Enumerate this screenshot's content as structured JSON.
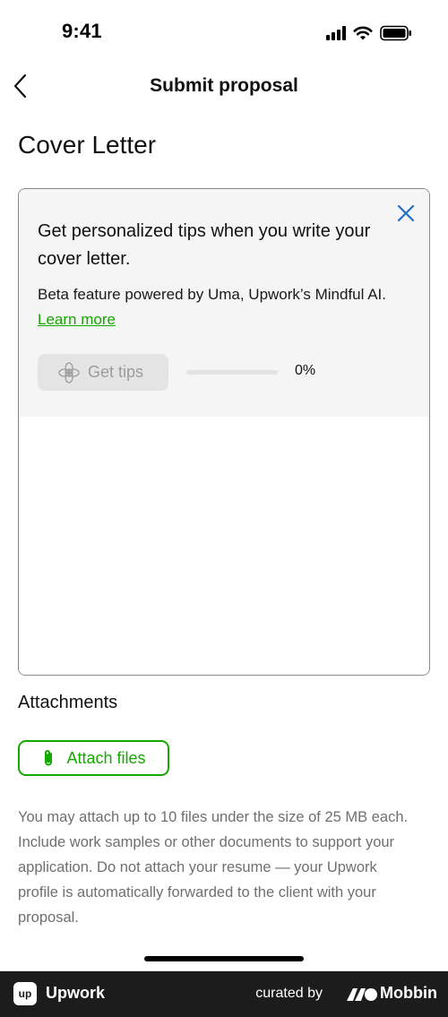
{
  "status_bar": {
    "time": "9:41",
    "icons": [
      "cellular-signal-icon",
      "wifi-icon",
      "battery-icon"
    ]
  },
  "nav": {
    "back_icon": "chevron-left-icon",
    "title": "Submit proposal"
  },
  "page": {
    "heading": "Cover Letter"
  },
  "tips": {
    "title": "Get personalized tips when you write your cover letter.",
    "description": "Beta feature powered by Uma, Upwork’s Mindful AI.",
    "learn_more": "Learn more",
    "button_label": "Get tips",
    "button_icon": "sparkle-flower-icon",
    "progress_percent": 0,
    "progress_label": "0%",
    "close_icon": "close-icon"
  },
  "cover_letter": {
    "value": "",
    "placeholder": ""
  },
  "attachments": {
    "heading": "Attachments",
    "button_label": "Attach files",
    "button_icon": "paperclip-icon",
    "note": "You may attach up to 10 files under the size of 25 MB each. Include work samples or other documents to support your application. Do not attach your resume — your Upwork profile is automatically forwarded to the client with your proposal."
  },
  "branding": {
    "app_name": "Upwork",
    "app_logo_text": "up",
    "curated_by": "curated by",
    "source_name": "Mobbin"
  },
  "colors": {
    "accent_green": "#14a800",
    "close_blue": "#1f6fc5",
    "brand_bar": "#1c1c1c"
  }
}
